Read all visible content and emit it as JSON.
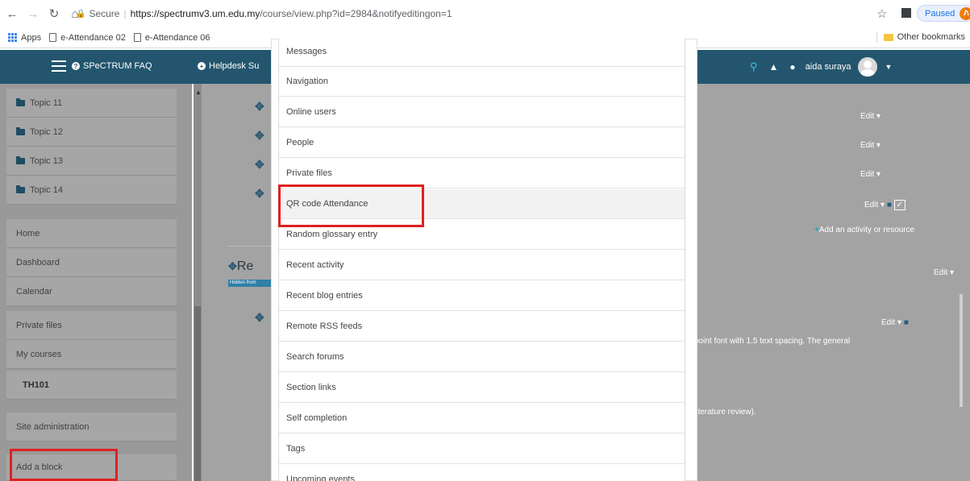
{
  "browser": {
    "url_secure_label": "Secure",
    "url_host": "https://spectrumv3.um.edu.my",
    "url_path": "/course/view.php?id=2984&notifyeditingon=1",
    "paused_label": "Paused",
    "profile_initial": "A",
    "bookmarks": [
      "Apps",
      "e-Attendance 02",
      "e-Attendance 06"
    ],
    "other_bookmarks": "Other bookmarks"
  },
  "navbar": {
    "faq_label": "SPeCTRUM FAQ",
    "helpdesk_label": "Helpdesk Su",
    "user_name": "aida suraya"
  },
  "drawer": {
    "topics": [
      "Topic 11",
      "Topic 12",
      "Topic 13",
      "Topic 14"
    ],
    "nav_items": [
      "Home",
      "Dashboard",
      "Calendar",
      "Private files",
      "My courses"
    ],
    "course_item": "TH101",
    "site_admin": "Site administration",
    "add_block": "Add a block"
  },
  "main": {
    "edit_label": "Edit",
    "add_activity": "Add an activity or resource",
    "section_title_fragment": "Re",
    "hidden_badge": "Hidden from",
    "text_fragment_1": "point font with 1.5 text spacing. The general",
    "text_fragment_2": "literature review)."
  },
  "block_list": {
    "items": [
      "Messages",
      "Navigation",
      "Online users",
      "People",
      "Private files",
      "QR code Attendance",
      "Random glossary entry",
      "Recent activity",
      "Recent blog entries",
      "Remote RSS feeds",
      "Search forums",
      "Section links",
      "Self completion",
      "Tags",
      "Upcoming events"
    ],
    "highlighted_index": 5
  },
  "colors": {
    "navbar": "#23566e",
    "highlight_box": "#e02020",
    "drawer_overlay": "#999999"
  }
}
